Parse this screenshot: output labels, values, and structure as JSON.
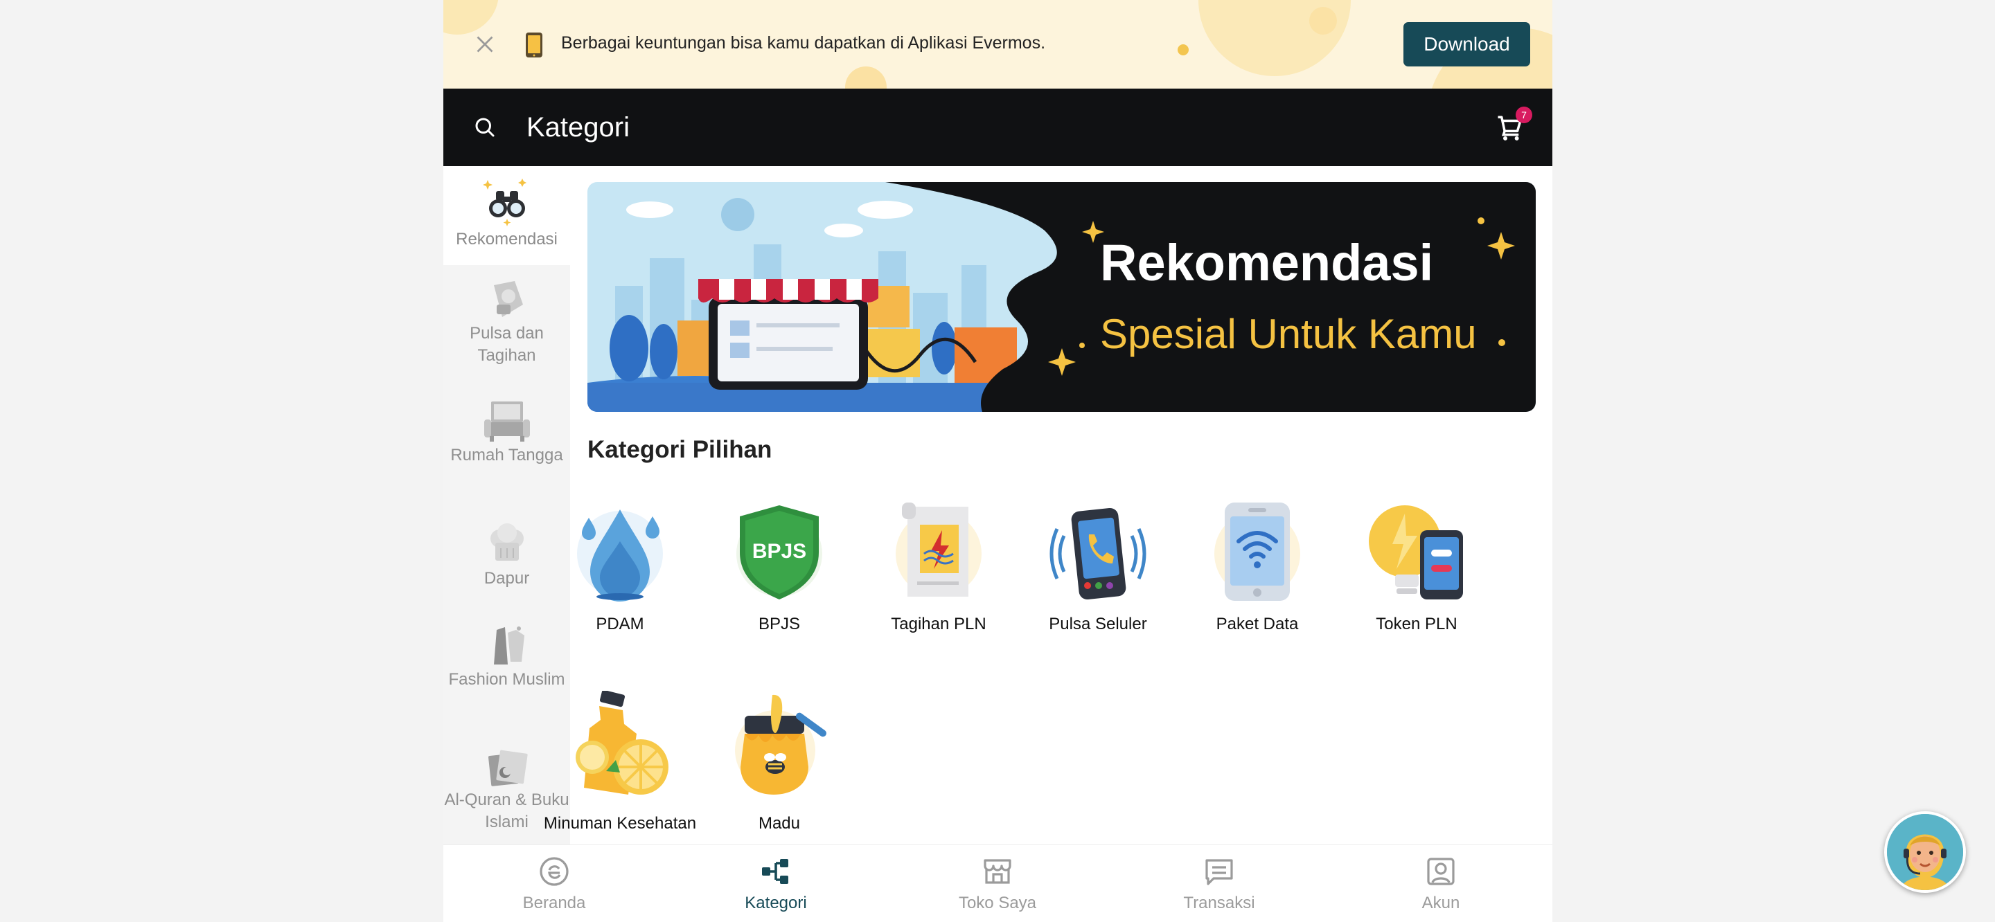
{
  "promo": {
    "text": "Berbagai keuntungan bisa kamu dapatkan di Aplikasi Evermos.",
    "download_label": "Download"
  },
  "header": {
    "title": "Kategori",
    "cart_count": "7"
  },
  "sidebar": {
    "items": [
      {
        "label": "Rekomendasi",
        "icon": "binoculars-icon"
      },
      {
        "label": "Pulsa dan Tagihan",
        "icon": "bill-icon"
      },
      {
        "label": "Rumah Tangga",
        "icon": "sofa-icon"
      },
      {
        "label": "Dapur",
        "icon": "chef-hat-icon"
      },
      {
        "label": "Fashion Muslim",
        "icon": "clothing-icon"
      },
      {
        "label": "Al-Quran & Buku Islami",
        "icon": "book-icon"
      }
    ]
  },
  "hero": {
    "title": "Rekomendasi",
    "subtitle": "Spesial Untuk Kamu"
  },
  "main": {
    "section_title": "Kategori Pilihan",
    "categories": [
      {
        "label": "PDAM",
        "icon": "water-drop-icon"
      },
      {
        "label": "BPJS",
        "icon": "bpjs-shield-icon"
      },
      {
        "label": "Tagihan PLN",
        "icon": "electric-bill-icon"
      },
      {
        "label": "Pulsa Seluler",
        "icon": "phone-call-icon"
      },
      {
        "label": "Paket Data",
        "icon": "wifi-phone-icon"
      },
      {
        "label": "Token PLN",
        "icon": "token-bulb-icon"
      },
      {
        "label": "Minuman Kesehatan",
        "icon": "juice-icon"
      },
      {
        "label": "Madu",
        "icon": "honey-jar-icon"
      }
    ]
  },
  "bottom_nav": {
    "items": [
      {
        "label": "Beranda",
        "icon": "home-e-icon"
      },
      {
        "label": "Kategori",
        "icon": "category-tree-icon"
      },
      {
        "label": "Toko Saya",
        "icon": "store-icon"
      },
      {
        "label": "Transaksi",
        "icon": "receipt-icon"
      },
      {
        "label": "Akun",
        "icon": "account-icon"
      }
    ],
    "active": "Kategori"
  },
  "colors": {
    "brand": "#174a57",
    "header_bg": "#101113",
    "promo_bg": "#fdf4dc",
    "badge": "#d81b60",
    "hero_accent": "#f5c242"
  }
}
